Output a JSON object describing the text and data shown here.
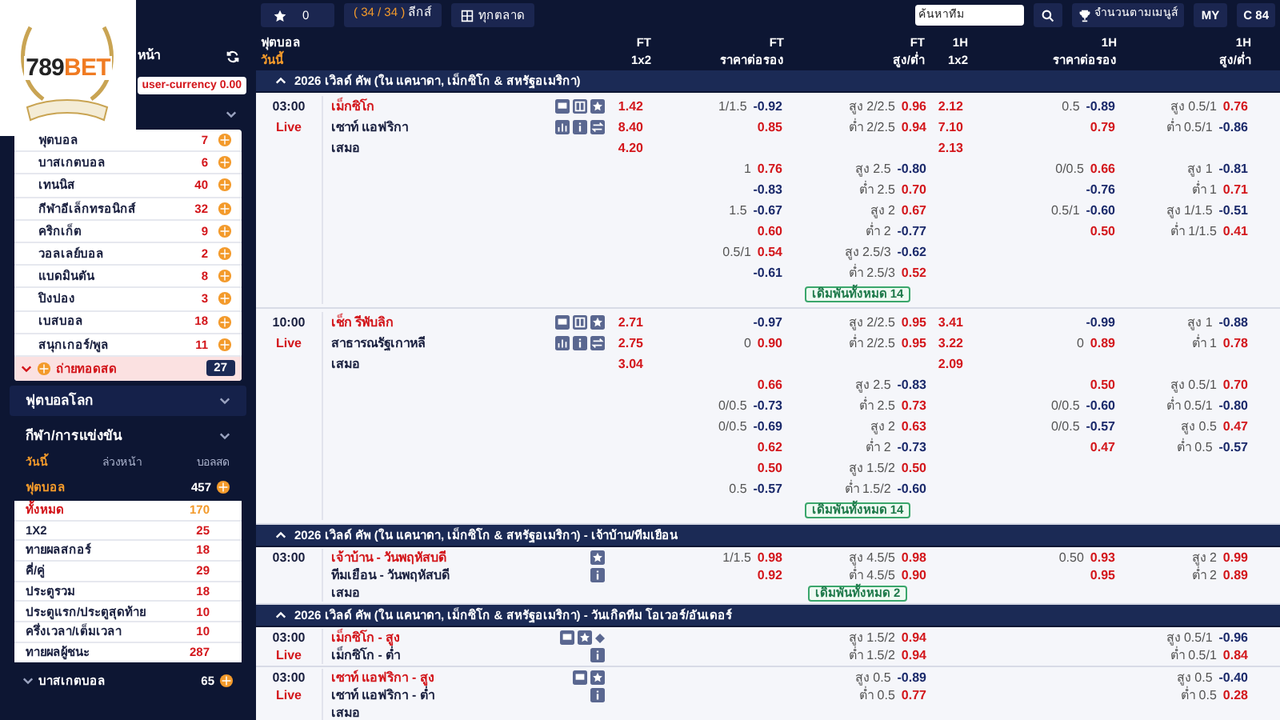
{
  "logo": {
    "part1": "789",
    "part2": "BET"
  },
  "sidebar": {
    "header": "หน้า",
    "currency": "user-currency 0.00",
    "sports": [
      {
        "name": "ฟุตบอล",
        "count": "7"
      },
      {
        "name": "บาสเกตบอล",
        "count": "6"
      },
      {
        "name": "เทนนิส",
        "count": "40"
      },
      {
        "name": "กีฬาอีเล็กทรอนิกส์",
        "count": "32"
      },
      {
        "name": "คริกเก็ต",
        "count": "9"
      },
      {
        "name": "วอลเลย์บอล",
        "count": "2"
      },
      {
        "name": "แบดมินตัน",
        "count": "8"
      },
      {
        "name": "ปิงปอง",
        "count": "3"
      },
      {
        "name": "เบสบอล",
        "count": "18"
      },
      {
        "name": "สนุกเกอร์/พูล",
        "count": "11"
      }
    ],
    "live": {
      "label": "ถ่ายทอดสด",
      "count": "27"
    },
    "sections": [
      {
        "label": "ฟุตบอลโลก"
      },
      {
        "label": "กีฬา/การแข่งขัน"
      }
    ],
    "tabs": [
      {
        "label": "วันนี้",
        "selected": true
      },
      {
        "label": "ล่วงหน้า",
        "selected": false
      },
      {
        "label": "บอลสด",
        "selected": false
      }
    ],
    "current_sport": {
      "name": "ฟุตบอล",
      "count": "457"
    },
    "markets": [
      {
        "name": "ทั้งหมด",
        "count": "170",
        "selected": true
      },
      {
        "name": "1X2",
        "count": "25",
        "selected": false
      },
      {
        "name": "ทายผลสกอร์",
        "count": "18",
        "selected": false
      },
      {
        "name": "คี่/คู่",
        "count": "29",
        "selected": false
      },
      {
        "name": "ประตูรวม",
        "count": "18",
        "selected": false
      },
      {
        "name": "ประตูแรก/ประตูสุดท้าย",
        "count": "10",
        "selected": false
      },
      {
        "name": "ครึ่งเวลา/เต็มเวลา",
        "count": "10",
        "selected": false
      },
      {
        "name": "ทายผลผู้ชนะ",
        "count": "287",
        "selected": false
      }
    ],
    "next_sport": {
      "name": "บาสเกตบอล",
      "count": "65"
    }
  },
  "topbar": {
    "favorites": "0",
    "leagues_count": "( 34 / 34 )",
    "leagues_label": "ลีกส์",
    "markets": "ทุกตลาด",
    "search": {
      "placeholder": "ค้นหาทีม"
    },
    "ranking": "จำนวนตามเมนูส์",
    "region": "MY",
    "credit": "C 84"
  },
  "header": {
    "sport": "ฟุตบอล",
    "day": "วันนี้",
    "columns": [
      {
        "period": "FT",
        "market": "1x2"
      },
      {
        "period": "FT",
        "market": "ราคาต่อรอง"
      },
      {
        "period": "FT",
        "market": "สูง/ต่ำ"
      },
      {
        "period": "1H",
        "market": "1x2"
      },
      {
        "period": "1H",
        "market": "ราคาต่อรอง"
      },
      {
        "period": "1H",
        "market": "สูง/ต่ำ"
      }
    ]
  },
  "groups": [
    {
      "title": "2026 เวิลด์ คัพ (ใน แคนาดา, เม็กซิโก & สหรัฐอเมริกา)",
      "expanded": true,
      "matches": [
        {
          "time": "03:00",
          "status": "Live",
          "rows": [
            {
              "team": "เม็กซิโก",
              "kind": "full-home",
              "ft_1x2": "1.42",
              "ft_hdp": {
                "line": "1/1.5",
                "odds": "-0.92"
              },
              "ft_ou": {
                "line": "สูง 2/2.5",
                "odds": "0.96"
              },
              "h1_1x2": "2.12",
              "h1_hdp": {
                "line": "0.5",
                "odds": "-0.89"
              },
              "h1_ou": {
                "line": "สูง 0.5/1",
                "odds": "0.76"
              }
            },
            {
              "team": "เซาท์ แอฟริกา",
              "kind": "full-away",
              "ft_1x2": "8.40",
              "ft_hdp": {
                "odds": "0.85"
              },
              "ft_ou": {
                "line": "ต่ำ 2/2.5",
                "odds": "0.94"
              },
              "h1_1x2": "7.10",
              "h1_hdp": {
                "odds": "0.79"
              },
              "h1_ou": {
                "line": "ต่ำ 0.5/1",
                "odds": "-0.86"
              }
            },
            {
              "team": "เสมอ",
              "ft_1x2": "4.20",
              "h1_1x2": "2.13"
            },
            {
              "ft_hdp": {
                "line": "1",
                "odds": "0.76"
              },
              "ft_ou": {
                "line": "สูง 2.5",
                "odds": "-0.80"
              },
              "h1_hdp": {
                "line": "0/0.5",
                "odds": "0.66"
              },
              "h1_ou": {
                "line": "สูง 1",
                "odds": "-0.81"
              }
            },
            {
              "ft_hdp": {
                "odds": "-0.83"
              },
              "ft_ou": {
                "line": "ต่ำ 2.5",
                "odds": "0.70"
              },
              "h1_hdp": {
                "odds": "-0.76"
              },
              "h1_ou": {
                "line": "ต่ำ 1",
                "odds": "0.71"
              }
            },
            {
              "ft_hdp": {
                "line": "1.5",
                "odds": "-0.67"
              },
              "ft_ou": {
                "line": "สูง 2",
                "odds": "0.67"
              },
              "h1_hdp": {
                "line": "0.5/1",
                "odds": "-0.60"
              },
              "h1_ou": {
                "line": "สูง 1/1.5",
                "odds": "-0.51"
              }
            },
            {
              "ft_hdp": {
                "odds": "0.60"
              },
              "ft_ou": {
                "line": "ต่ำ 2",
                "odds": "-0.77"
              },
              "h1_hdp": {
                "odds": "0.50"
              },
              "h1_ou": {
                "line": "ต่ำ 1/1.5",
                "odds": "0.41"
              }
            },
            {
              "ft_hdp": {
                "line": "0.5/1",
                "odds": "0.54"
              },
              "ft_ou": {
                "line": "สูง 2.5/3",
                "odds": "-0.62"
              }
            },
            {
              "ft_hdp": {
                "odds": "-0.61"
              },
              "ft_ou": {
                "line": "ต่ำ 2.5/3",
                "odds": "0.52"
              }
            },
            {
              "more": "เดิมพันทั้งหมด 14"
            }
          ]
        },
        {
          "time": "10:00",
          "status": "Live",
          "rows": [
            {
              "team": "เช็ก รีพับลิก",
              "kind": "full-home",
              "ft_1x2": "2.71",
              "ft_hdp": {
                "odds": "-0.97"
              },
              "ft_ou": {
                "line": "สูง 2/2.5",
                "odds": "0.95"
              },
              "h1_1x2": "3.41",
              "h1_hdp": {
                "odds": "-0.99"
              },
              "h1_ou": {
                "line": "สูง 1",
                "odds": "-0.88"
              }
            },
            {
              "team": "สาธารณรัฐเกาหลี",
              "kind": "full-away",
              "ft_1x2": "2.75",
              "ft_hdp": {
                "line": "0",
                "odds": "0.90"
              },
              "ft_ou": {
                "line": "ต่ำ 2/2.5",
                "odds": "0.95"
              },
              "h1_1x2": "3.22",
              "h1_hdp": {
                "line": "0",
                "odds": "0.89"
              },
              "h1_ou": {
                "line": "ต่ำ 1",
                "odds": "0.78"
              }
            },
            {
              "team": "เสมอ",
              "ft_1x2": "3.04",
              "h1_1x2": "2.09"
            },
            {
              "ft_hdp": {
                "odds": "0.66"
              },
              "ft_ou": {
                "line": "สูง 2.5",
                "odds": "-0.83"
              },
              "h1_hdp": {
                "odds": "0.50"
              },
              "h1_ou": {
                "line": "สูง 0.5/1",
                "odds": "0.70"
              }
            },
            {
              "ft_hdp": {
                "line": "0/0.5",
                "odds": "-0.73"
              },
              "ft_ou": {
                "line": "ต่ำ 2.5",
                "odds": "0.73"
              },
              "h1_hdp": {
                "line": "0/0.5",
                "odds": "-0.60"
              },
              "h1_ou": {
                "line": "ต่ำ 0.5/1",
                "odds": "-0.80"
              }
            },
            {
              "ft_hdp": {
                "line": "0/0.5",
                "odds": "-0.69"
              },
              "ft_ou": {
                "line": "สูง 2",
                "odds": "0.63"
              },
              "h1_hdp": {
                "line": "0/0.5",
                "odds": "-0.57"
              },
              "h1_ou": {
                "line": "สูง 0.5",
                "odds": "0.47"
              }
            },
            {
              "ft_hdp": {
                "odds": "0.62"
              },
              "ft_ou": {
                "line": "ต่ำ 2",
                "odds": "-0.73"
              },
              "h1_hdp": {
                "odds": "0.47"
              },
              "h1_ou": {
                "line": "ต่ำ 0.5",
                "odds": "-0.57"
              }
            },
            {
              "ft_hdp": {
                "odds": "0.50"
              },
              "ft_ou": {
                "line": "สูง 1.5/2",
                "odds": "0.50"
              }
            },
            {
              "ft_hdp": {
                "line": "0.5",
                "odds": "-0.57"
              },
              "ft_ou": {
                "line": "ต่ำ 1.5/2",
                "odds": "-0.60"
              }
            },
            {
              "more": "เดิมพันทั้งหมด 14"
            }
          ]
        }
      ]
    },
    {
      "title": "2026 เวิลด์ คัพ (ใน แคนาดา, เม็กซิโก & สหรัฐอเมริกา) - เจ้าบ้าน/ทีมเยือน",
      "expanded": true,
      "matches": [
        {
          "time": "03:00",
          "rows": [
            {
              "team": "เจ้าบ้าน - วันพฤหัสบดี",
              "kind": "side-home",
              "ft_hdp": {
                "line": "1/1.5",
                "odds": "0.98"
              },
              "ft_ou": {
                "line": "สูง 4.5/5",
                "odds": "0.98"
              },
              "h1_hdp": {
                "line": "0.50",
                "odds": "0.93"
              },
              "h1_ou": {
                "line": "สูง 2",
                "odds": "0.99"
              }
            },
            {
              "team": "ทีมเยือน - วันพฤหัสบดี",
              "kind": "side-away",
              "ft_hdp": {
                "odds": "0.92"
              },
              "ft_ou": {
                "line": "ต่ำ 4.5/5",
                "odds": "0.90"
              },
              "h1_hdp": {
                "odds": "0.95"
              },
              "h1_ou": {
                "line": "ต่ำ 2",
                "odds": "0.89"
              }
            },
            {
              "team": "เสมอ",
              "more": "เดิมพันทั้งหมด 2"
            }
          ]
        }
      ]
    },
    {
      "title": "2026 เวิลด์ คัพ (ใน แคนาดา, เม็กซิโก & สหรัฐอเมริกา) - วันเกิดทีม โอเวอร์/อันเดอร์",
      "expanded": true,
      "matches": [
        {
          "time": "03:00",
          "status": "Live",
          "rows": [
            {
              "team": "เม็กซิโก - สูง",
              "kind": "over-pinned",
              "ft_ou": {
                "line": "สูง 1.5/2",
                "odds": "0.94"
              },
              "h1_ou": {
                "line": "สูง 0.5/1",
                "odds": "-0.96"
              }
            },
            {
              "team": "เม็กซิโก - ต่ำ",
              "kind": "side-away",
              "ft_ou": {
                "line": "ต่ำ 1.5/2",
                "odds": "0.94"
              },
              "h1_ou": {
                "line": "ต่ำ 0.5/1",
                "odds": "0.84"
              }
            }
          ]
        },
        {
          "time": "03:00",
          "status": "Live",
          "rows": [
            {
              "team": "เซาท์ แอฟริกา - สูง",
              "kind": "over",
              "ft_ou": {
                "line": "สูง 0.5",
                "odds": "-0.89"
              },
              "h1_ou": {
                "line": "สูง 0.5",
                "odds": "-0.40"
              }
            },
            {
              "team": "เซาท์ แอฟริกา - ต่ำ",
              "kind": "side-away",
              "ft_ou": {
                "line": "ต่ำ 0.5",
                "odds": "0.77"
              },
              "h1_ou": {
                "line": "ต่ำ 0.5",
                "odds": "0.28"
              }
            },
            {
              "team": "เสมอ"
            }
          ]
        }
      ]
    }
  ]
}
